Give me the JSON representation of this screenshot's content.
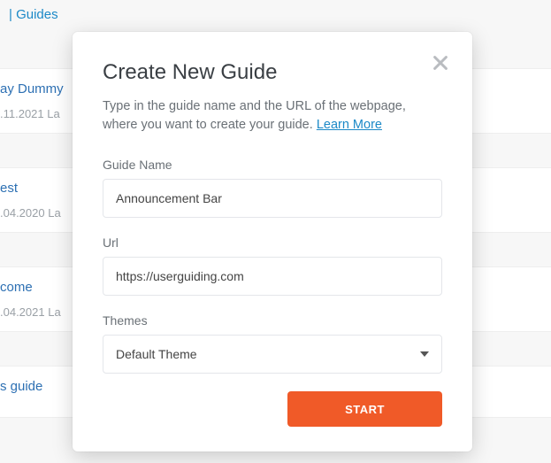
{
  "header": {
    "crumb": "| Guides"
  },
  "list": {
    "items": [
      {
        "title": "ay Dummy",
        "meta": ".11.2021   La"
      },
      {
        "title": "est",
        "meta": ".04.2020   La"
      },
      {
        "title": "come",
        "meta": ".04.2021   La"
      },
      {
        "title": "s guide",
        "meta": ""
      }
    ]
  },
  "modal": {
    "title": "Create New Guide",
    "description_pre": "Type in the guide name and the URL of the webpage, where you want to create your guide. ",
    "learn_more": "Learn More",
    "fields": {
      "name": {
        "label": "Guide Name",
        "value": "Announcement Bar"
      },
      "url": {
        "label": "Url",
        "value": "https://userguiding.com"
      },
      "theme": {
        "label": "Themes",
        "selected": "Default Theme"
      }
    },
    "start": "START"
  }
}
